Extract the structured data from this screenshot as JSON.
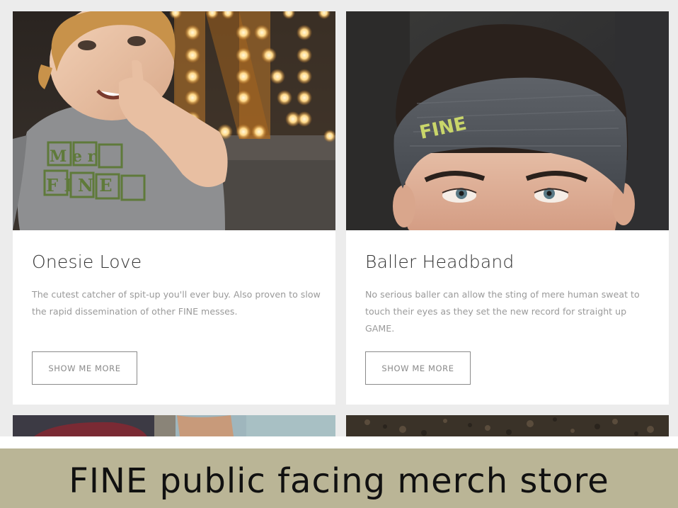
{
  "products": [
    {
      "title": "Onesie Love",
      "description": "The cutest catcher of spit-up you'll ever buy. Also proven to slow the rapid dissemination of other FINE messes.",
      "button_label": "SHOW ME MORE",
      "shirt_print": "FINE",
      "shirt_print_top": "MER"
    },
    {
      "title": "Baller Headband",
      "description": "No serious baller can allow the sting of mere human sweat to touch their eyes as they set the new record for straight up GAME.",
      "button_label": "SHOW ME MORE",
      "headband_print": "FINE"
    }
  ],
  "banner": {
    "text": "FINE public facing merch store"
  },
  "colors": {
    "page_background": "#ececec",
    "card_background": "#ffffff",
    "banner_background": "#bab596",
    "title_text": "#333333",
    "body_text": "#9a9a9a",
    "button_border": "#8a8a8a"
  }
}
